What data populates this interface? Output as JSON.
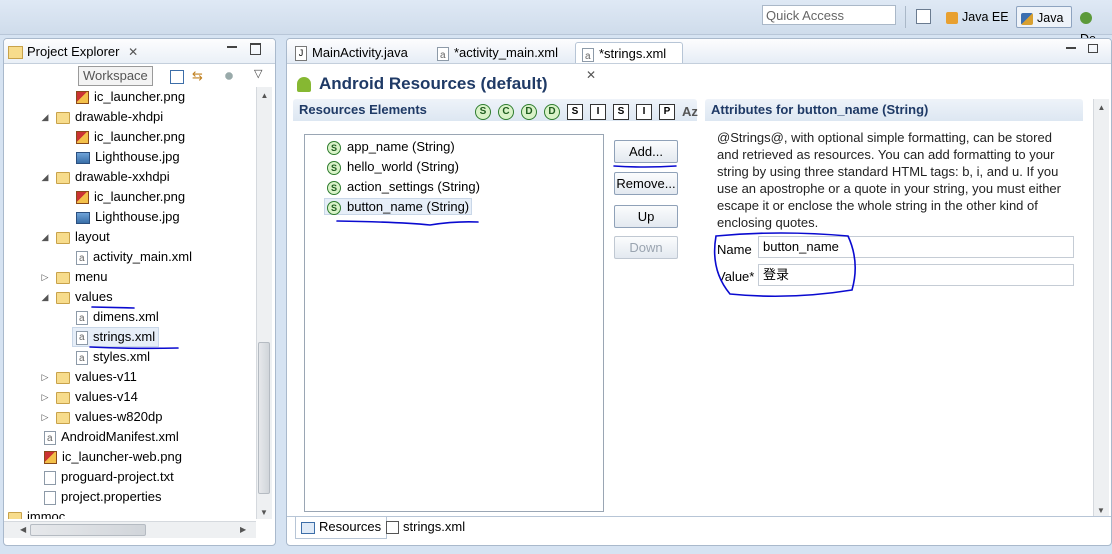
{
  "toolbar": {
    "quick_access_placeholder": "Quick Access",
    "perspectives": [
      {
        "label": "Java EE",
        "icon": "java-ee-perspective-icon"
      },
      {
        "label": "Java",
        "icon": "java-perspective-icon",
        "active": true
      },
      {
        "label": "De",
        "icon": "debug-perspective-icon"
      }
    ]
  },
  "project_explorer": {
    "title": "Project Explorer",
    "tooltip": "Workspace",
    "tree": [
      {
        "label": "ic_launcher.png",
        "type": "png",
        "depth": 2
      },
      {
        "label": "drawable-xhdpi",
        "type": "folder",
        "depth": 1,
        "expanded": true
      },
      {
        "label": "ic_launcher.png",
        "type": "png",
        "depth": 2
      },
      {
        "label": "Lighthouse.jpg",
        "type": "jpg",
        "depth": 2
      },
      {
        "label": "drawable-xxhdpi",
        "type": "folder",
        "depth": 1,
        "expanded": true
      },
      {
        "label": "ic_launcher.png",
        "type": "png",
        "depth": 2
      },
      {
        "label": "Lighthouse.jpg",
        "type": "jpg",
        "depth": 2
      },
      {
        "label": "layout",
        "type": "folder",
        "depth": 1,
        "expanded": true
      },
      {
        "label": "activity_main.xml",
        "type": "xml",
        "depth": 2
      },
      {
        "label": "menu",
        "type": "folder",
        "depth": 1,
        "expanded": false
      },
      {
        "label": "values",
        "type": "folder",
        "depth": 1,
        "expanded": true
      },
      {
        "label": "dimens.xml",
        "type": "xml",
        "depth": 2
      },
      {
        "label": "strings.xml",
        "type": "xml",
        "depth": 2,
        "selected": true
      },
      {
        "label": "styles.xml",
        "type": "xml",
        "depth": 2
      },
      {
        "label": "values-v11",
        "type": "folder",
        "depth": 1,
        "expanded": false
      },
      {
        "label": "values-v14",
        "type": "folder",
        "depth": 1,
        "expanded": false
      },
      {
        "label": "values-w820dp",
        "type": "folder",
        "depth": 1,
        "expanded": false
      },
      {
        "label": "AndroidManifest.xml",
        "type": "xml",
        "depth": 0
      },
      {
        "label": "ic_launcher-web.png",
        "type": "png",
        "depth": 0
      },
      {
        "label": "proguard-project.txt",
        "type": "txt",
        "depth": 0
      },
      {
        "label": "project.properties",
        "type": "txt",
        "depth": 0
      },
      {
        "label": "immoc",
        "type": "project",
        "depth": -1
      }
    ]
  },
  "editor": {
    "tabs": [
      {
        "label": "MainActivity.java",
        "icon": "java-file-icon"
      },
      {
        "label": "*activity_main.xml",
        "icon": "xml-file-icon"
      },
      {
        "label": "*strings.xml",
        "icon": "xml-file-icon",
        "active": true
      }
    ],
    "title": "Android Resources (default)",
    "resources_header": "Resources Elements",
    "filter_buttons": [
      "S",
      "C",
      "D",
      "D",
      "S",
      "I",
      "S",
      "I",
      "P"
    ],
    "sort_label": "Az",
    "resources": [
      "app_name (String)",
      "hello_world (String)",
      "action_settings (String)",
      "button_name (String)"
    ],
    "buttons": {
      "add": "Add...",
      "remove": "Remove...",
      "up": "Up",
      "down": "Down"
    },
    "attributes_header": "Attributes for button_name (String)",
    "description": "@Strings@, with optional simple formatting, can be stored and retrieved as resources. You can add formatting to your string by using three standard HTML tags: b, i, and u. If you use an apostrophe or a quote in your string, you must either escape it or enclose the whole string in the other kind of enclosing quotes.",
    "name_label": "Name",
    "name_value": "button_name",
    "value_label": "Value*",
    "value_value": "登录",
    "bottom_tabs": [
      "Resources",
      "strings.xml"
    ]
  }
}
